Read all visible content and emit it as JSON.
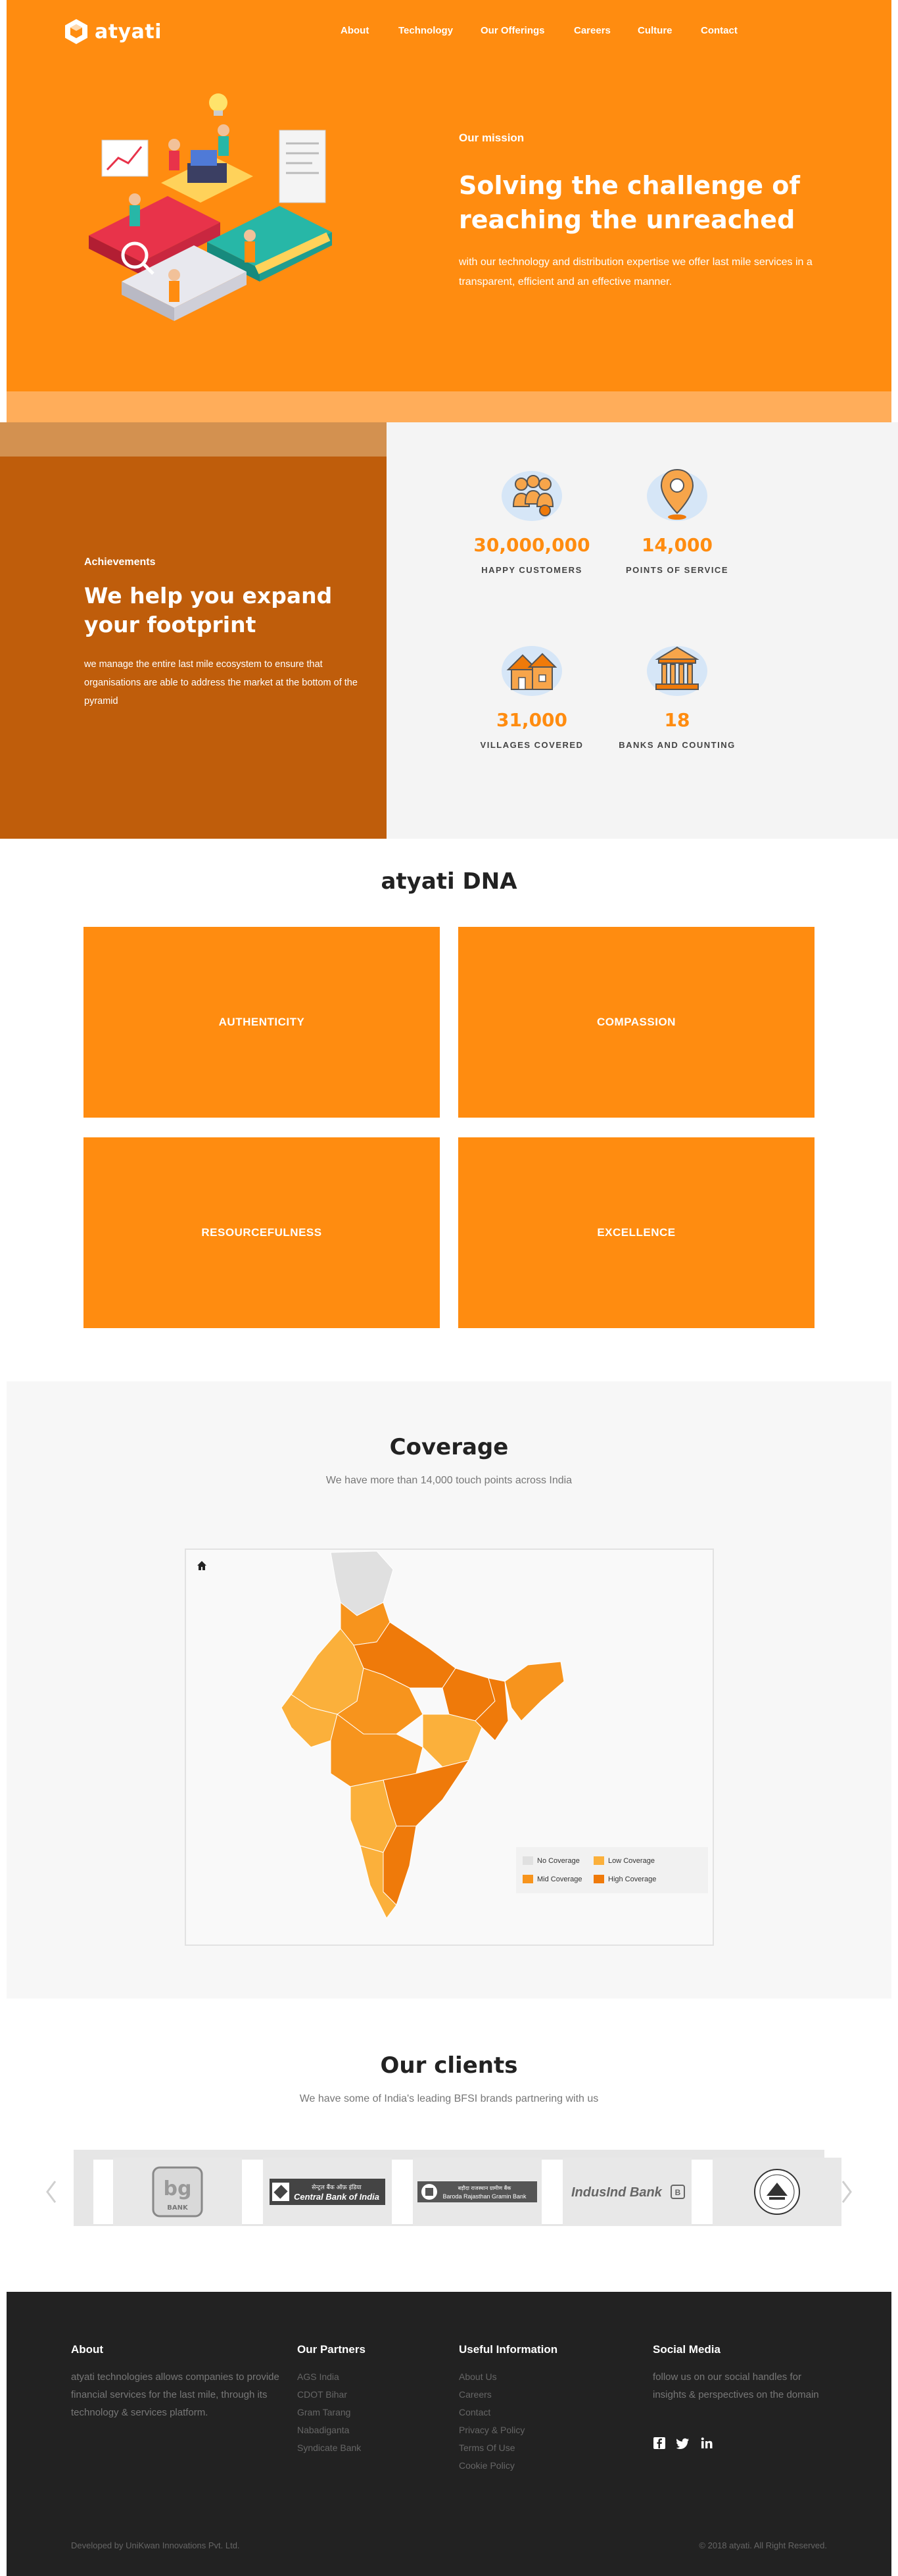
{
  "brand": {
    "name": "atyati",
    "accent": "#ff8c10",
    "dark_accent": "#bf5d0b"
  },
  "nav": {
    "items": [
      {
        "label": "About"
      },
      {
        "label": "Technology"
      },
      {
        "label": "Our Offerings"
      },
      {
        "label": "Careers"
      },
      {
        "label": "Culture"
      },
      {
        "label": "Contact"
      }
    ]
  },
  "hero": {
    "label": "Our mission",
    "title": "Solving the challenge of reaching the unreached",
    "text": "with our technology and distribution expertise we offer last mile services in a transparent, efficient and an effective manner."
  },
  "achievements": {
    "label": "Achievements",
    "title": "We help you expand your footprint",
    "text": "we manage the entire last mile ecosystem to ensure that organisations are able to address the market at the bottom of the pyramid",
    "stats": [
      {
        "value": "30,000,000",
        "label": "HAPPY CUSTOMERS",
        "icon": "people-icon"
      },
      {
        "value": "14,000",
        "label": "POINTS OF SERVICE",
        "icon": "location-pin-icon"
      },
      {
        "value": "31,000",
        "label": "VILLAGES COVERED",
        "icon": "village-icon"
      },
      {
        "value": "18",
        "label": "BANKS AND COUNTING",
        "icon": "bank-icon"
      }
    ]
  },
  "dna": {
    "title": "atyati DNA",
    "values": [
      "AUTHENTICITY",
      "COMPASSION",
      "RESOURCEFULNESS",
      "EXCELLENCE"
    ]
  },
  "coverage": {
    "title": "Coverage",
    "subtitle": "We have more than 14,000 touch points across India",
    "legend": [
      {
        "label": "No Coverage",
        "color": "#e0e0e0"
      },
      {
        "label": "Low Coverage",
        "color": "#fbb03b"
      },
      {
        "label": "Mid Coverage",
        "color": "#f7941d"
      },
      {
        "label": "High Coverage",
        "color": "#ef7a0a"
      }
    ]
  },
  "clients": {
    "title": "Our clients",
    "subtitle": "We have some of India's leading BFSI brands partnering with us",
    "logos": [
      {
        "name": "bg-bank-logo",
        "text": "BANK"
      },
      {
        "name": "central-bank-logo",
        "text": "Central Bank of India"
      },
      {
        "name": "rural-bank-logo",
        "text": "Baroda Rajasthan Gramin Bank"
      },
      {
        "name": "indusind-bank-logo",
        "text": "IndusInd Bank"
      },
      {
        "name": "seal-bank-logo",
        "text": ""
      }
    ]
  },
  "footer": {
    "about": {
      "heading": "About",
      "text": "atyati technologies allows companies to provide financial services for the last mile, through its technology & services platform."
    },
    "partners": {
      "heading": "Our Partners",
      "links": [
        "AGS India",
        "CDOT Bihar",
        "Gram Tarang",
        "Nabadiganta",
        "Syndicate Bank"
      ]
    },
    "useful": {
      "heading": "Useful Information",
      "links": [
        "About Us",
        "Careers",
        "Contact",
        "Privacy & Policy",
        "Terms Of Use",
        "Cookie Policy"
      ]
    },
    "social": {
      "heading": "Social Media",
      "text": "follow us on our social handles for insights & perspectives on the domain",
      "icons": [
        "facebook-icon",
        "twitter-icon",
        "linkedin-icon"
      ]
    },
    "developed_by": "Developed by UniKwan Innovations Pvt. Ltd.",
    "copyright": "© 2018 atyati. All Right Reserved."
  }
}
